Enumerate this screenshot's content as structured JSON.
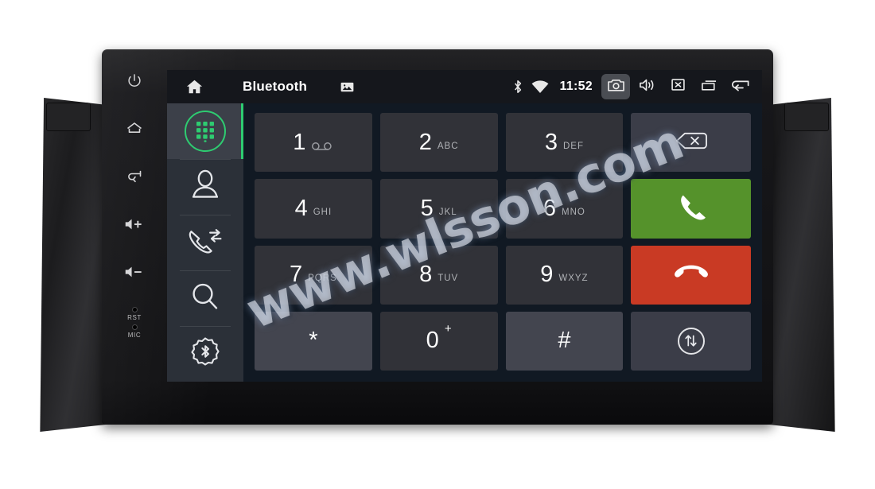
{
  "device": {
    "hardware_buttons": [
      {
        "name": "power",
        "icon": "power-icon"
      },
      {
        "name": "home",
        "icon": "home-icon"
      },
      {
        "name": "back",
        "icon": "back-icon"
      },
      {
        "name": "volume-up",
        "icon": "volume-up-icon"
      },
      {
        "name": "volume-down",
        "icon": "volume-down-icon"
      }
    ],
    "pinholes": [
      {
        "label": "RST",
        "name": "reset-pinhole"
      },
      {
        "label": "MIC",
        "name": "microphone-pinhole"
      }
    ]
  },
  "watermark": {
    "text": "www.wlsson.com"
  },
  "statusbar": {
    "home_icon": "home-icon",
    "title": "Bluetooth",
    "gallery_icon": "image-icon",
    "bluetooth_icon": "bluetooth-icon",
    "wifi_icon": "wifi-icon",
    "clock": "11:52",
    "buttons": [
      {
        "name": "screenshot-button",
        "icon": "camera-icon",
        "pressed": true
      },
      {
        "name": "volume-button",
        "icon": "speaker-icon",
        "pressed": false
      },
      {
        "name": "close-button",
        "icon": "close-box-icon",
        "pressed": false
      },
      {
        "name": "recents-button",
        "icon": "recents-icon",
        "pressed": false
      },
      {
        "name": "back-button",
        "icon": "back-arrow-icon",
        "pressed": false
      }
    ]
  },
  "sidebar": {
    "accent_color": "#2ecc71",
    "items": [
      {
        "name": "dialpad",
        "icon": "dialpad-icon",
        "active": true
      },
      {
        "name": "contacts",
        "icon": "contact-icon",
        "active": false
      },
      {
        "name": "call-log",
        "icon": "call-sync-icon",
        "active": false
      },
      {
        "name": "search",
        "icon": "search-icon",
        "active": false
      },
      {
        "name": "bt-settings",
        "icon": "bluetooth-gear-icon",
        "active": false
      }
    ]
  },
  "dialpad": {
    "keys": [
      {
        "digit": "1",
        "letters": "",
        "glyph": "voicemail-icon",
        "style": "normal"
      },
      {
        "digit": "2",
        "letters": "ABC",
        "glyph": "",
        "style": "normal"
      },
      {
        "digit": "3",
        "letters": "DEF",
        "glyph": "",
        "style": "normal"
      },
      {
        "digit": "4",
        "letters": "GHI",
        "glyph": "",
        "style": "normal"
      },
      {
        "digit": "5",
        "letters": "JKL",
        "glyph": "",
        "style": "normal"
      },
      {
        "digit": "6",
        "letters": "MNO",
        "glyph": "",
        "style": "normal"
      },
      {
        "digit": "7",
        "letters": "PQRS",
        "glyph": "",
        "style": "normal"
      },
      {
        "digit": "8",
        "letters": "TUV",
        "glyph": "",
        "style": "normal"
      },
      {
        "digit": "9",
        "letters": "WXYZ",
        "glyph": "",
        "style": "normal"
      },
      {
        "digit": "*",
        "letters": "",
        "glyph": "",
        "style": "alt"
      },
      {
        "digit": "0",
        "letters": "",
        "glyph": "plus-sup",
        "style": "normal"
      },
      {
        "digit": "#",
        "letters": "",
        "glyph": "",
        "style": "alt"
      }
    ],
    "actions": [
      {
        "name": "backspace-button",
        "icon": "backspace-icon",
        "style": "neutral",
        "color": "#3b3d48"
      },
      {
        "name": "call-button",
        "icon": "phone-icon",
        "style": "call",
        "color": "#55922b"
      },
      {
        "name": "hangup-button",
        "icon": "hangup-icon",
        "style": "end",
        "color": "#c93a24"
      },
      {
        "name": "audio-transfer-button",
        "icon": "transfer-arrows-icon",
        "style": "neutral",
        "color": "#3b3d48"
      }
    ]
  }
}
